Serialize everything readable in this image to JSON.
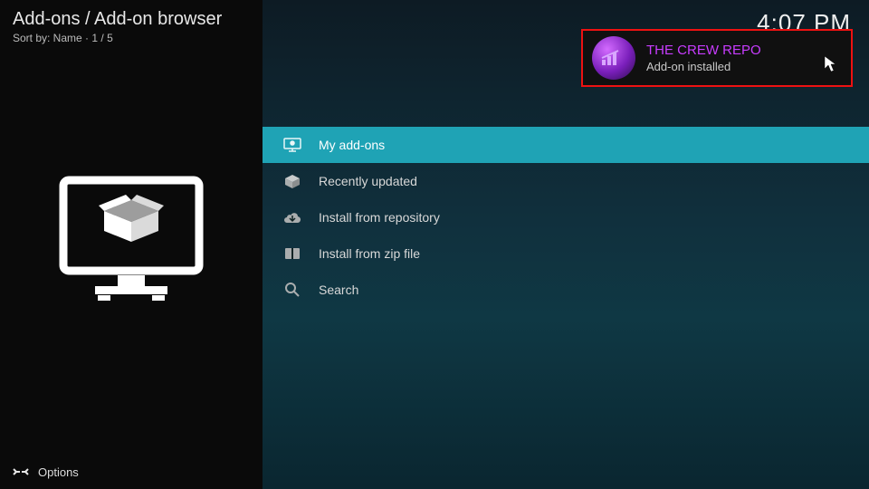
{
  "header": {
    "breadcrumb": "Add-ons / Add-on browser",
    "sort_label": "Sort by: Name",
    "page_indicator": "1 / 5"
  },
  "clock": "4:07 PM",
  "toast": {
    "title": "THE CREW REPO",
    "subtitle": "Add-on installed"
  },
  "menu": {
    "items": [
      {
        "label": "My add-ons",
        "selected": true
      },
      {
        "label": "Recently updated",
        "selected": false
      },
      {
        "label": "Install from repository",
        "selected": false
      },
      {
        "label": "Install from zip file",
        "selected": false
      },
      {
        "label": "Search",
        "selected": false
      }
    ]
  },
  "footer": {
    "options": "Options"
  }
}
